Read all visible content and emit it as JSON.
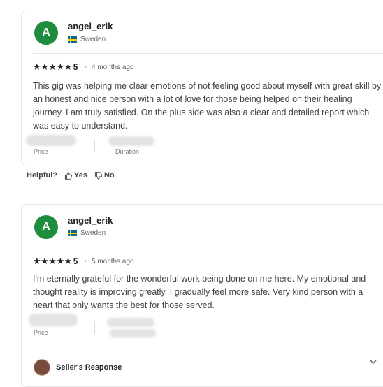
{
  "reviews": [
    {
      "avatar_letter": "A",
      "username": "angel_erik",
      "country": "Sweden",
      "stars": "★★★★★",
      "rating": "5",
      "time": "4 months ago",
      "text": "This gig was helping me clear emotions of not feeling good about myself with great skill by an honest and nice person with a lot of love for those being helped on their healing journey. I am truly satisfied. On the plus side was also a clear and detailed report which was easy to understand.",
      "price_label": "Price",
      "duration_label": "Duration"
    },
    {
      "avatar_letter": "A",
      "username": "angel_erik",
      "country": "Sweden",
      "stars": "★★★★★",
      "rating": "5",
      "time": "5 months ago",
      "text": "I'm eternally grateful for the wonderful work being done on me here. My emotional and thought reality is improving greatly. I gradually feel more safe. Very kind person with a heart that only wants the best for those served.",
      "price_label": "Price"
    }
  ],
  "helpful": {
    "label": "Helpful?",
    "yes": "Yes",
    "no": "No"
  },
  "seller_response": {
    "label": "Seller's Response"
  },
  "colors": {
    "avatar_bg": "#1e8e3e",
    "text": "#404145"
  },
  "icons": {
    "thumbs_up": "thumbs-up-icon",
    "thumbs_down": "thumbs-down-icon",
    "expand": "chevron-down-icon"
  }
}
